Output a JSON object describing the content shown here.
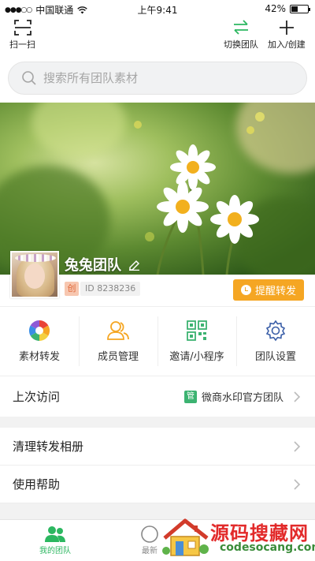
{
  "status_bar": {
    "signal": "●●●○○",
    "carrier": "中国联通",
    "time": "上午9:41",
    "battery": "42%",
    "battery_level": 0.42
  },
  "top_bar": {
    "scan_label": "扫一扫",
    "switch_label": "切换团队",
    "join_label": "加入/创建"
  },
  "search": {
    "placeholder": "搜索所有团队素材"
  },
  "team": {
    "name": "兔兔团队",
    "creator_badge": "创",
    "id_text": "ID 8238236",
    "remind_label": "提醒转发"
  },
  "actions": [
    {
      "label": "素材转发",
      "icon": "aperture-icon"
    },
    {
      "label": "成员管理",
      "icon": "members-icon"
    },
    {
      "label": "邀请/小程序",
      "icon": "qrcode-icon"
    },
    {
      "label": "团队设置",
      "icon": "gear-icon"
    }
  ],
  "last_visit": {
    "label": "上次访问",
    "team_badge": "管",
    "team_name": "微商水印官方团队"
  },
  "menu": [
    {
      "label": "清理转发相册"
    },
    {
      "label": "使用帮助"
    }
  ],
  "tab_bar": {
    "my_team": "我的团队",
    "latest": "最新"
  },
  "watermark": {
    "title": "源码搜藏网",
    "url": "codesocang.com"
  },
  "colors": {
    "accent_green": "#2cb760",
    "remind_orange": "#f5a623",
    "badge_green": "#3cb371"
  }
}
